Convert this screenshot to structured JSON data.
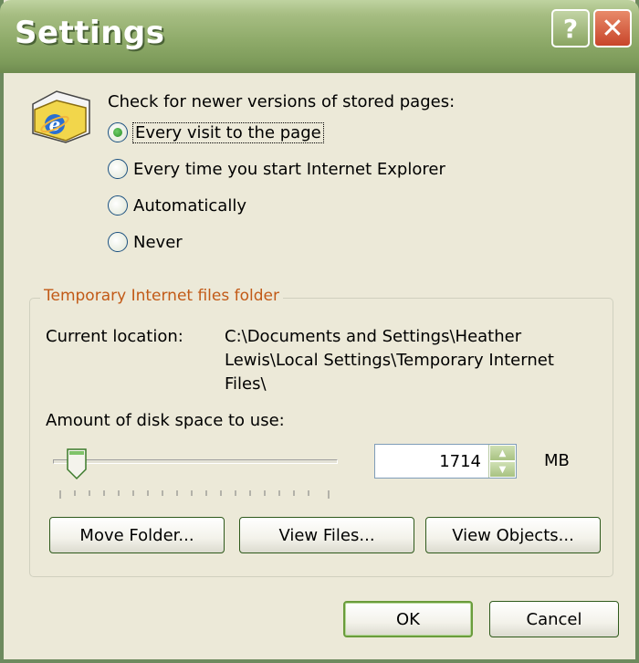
{
  "window": {
    "title": "Settings",
    "help_glyph": "?",
    "close_glyph": "✕"
  },
  "check_section": {
    "prompt": "Check for newer versions of stored pages:",
    "options": [
      {
        "label": "Every visit to the page",
        "selected": true
      },
      {
        "label": "Every time you start Internet Explorer",
        "selected": false
      },
      {
        "label": "Automatically",
        "selected": false
      },
      {
        "label": "Never",
        "selected": false
      }
    ]
  },
  "temp_files": {
    "group_title": "Temporary Internet files folder",
    "location_label": "Current location:",
    "location_line1": "C:\\Documents and Settings\\Heather",
    "location_line2": "Lewis\\Local Settings\\Temporary Internet",
    "location_line3": "Files\\",
    "disk_label": "Amount of disk space to use:",
    "disk_value": "1714",
    "disk_unit": "MB",
    "slider_fraction": 0.08
  },
  "buttons": {
    "move_folder": "Move Folder...",
    "view_files": "View Files...",
    "view_objects": "View Objects...",
    "ok": "OK",
    "cancel": "Cancel"
  },
  "colors": {
    "titlebar": "#8fab6a",
    "group_title": "#c25a17",
    "dialog_bg": "#ece9d8"
  },
  "icons": [
    "ie-folder-icon",
    "help-icon",
    "close-icon",
    "slider-thumb-icon",
    "spin-up-icon",
    "spin-down-icon"
  ]
}
